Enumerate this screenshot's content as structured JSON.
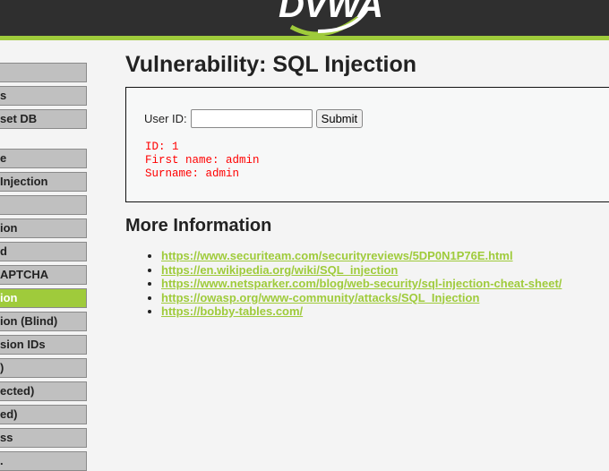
{
  "header": {
    "logo_text": "DVWA",
    "accent_color": "#9fcb3b"
  },
  "sidebar": {
    "items": [
      {
        "label": ""
      },
      {
        "label": "s"
      },
      {
        "label": "set DB"
      },
      {
        "label": "e"
      },
      {
        "label": " Injection"
      },
      {
        "label": ""
      },
      {
        "label": "ion"
      },
      {
        "label": "d"
      },
      {
        "label": "APTCHA"
      },
      {
        "label": "ion",
        "active": true
      },
      {
        "label": "ion (Blind)"
      },
      {
        "label": "sion IDs"
      },
      {
        "label": ")"
      },
      {
        "label": "ected)"
      },
      {
        "label": "ed)"
      },
      {
        "label": "ss"
      },
      {
        "label": "."
      }
    ]
  },
  "main": {
    "title": "Vulnerability: SQL Injection",
    "form": {
      "user_id_label": "User ID:",
      "user_id_value": "",
      "submit_label": "Submit"
    },
    "result": {
      "line1": "ID: 1",
      "line2": "First name: admin",
      "line3": "Surname: admin"
    },
    "more_info_title": "More Information",
    "links": [
      "https://www.securiteam.com/securityreviews/5DP0N1P76E.html",
      "https://en.wikipedia.org/wiki/SQL_injection",
      "https://www.netsparker.com/blog/web-security/sql-injection-cheat-sheet/",
      "https://owasp.org/www-community/attacks/SQL_Injection",
      "https://bobby-tables.com/"
    ]
  }
}
